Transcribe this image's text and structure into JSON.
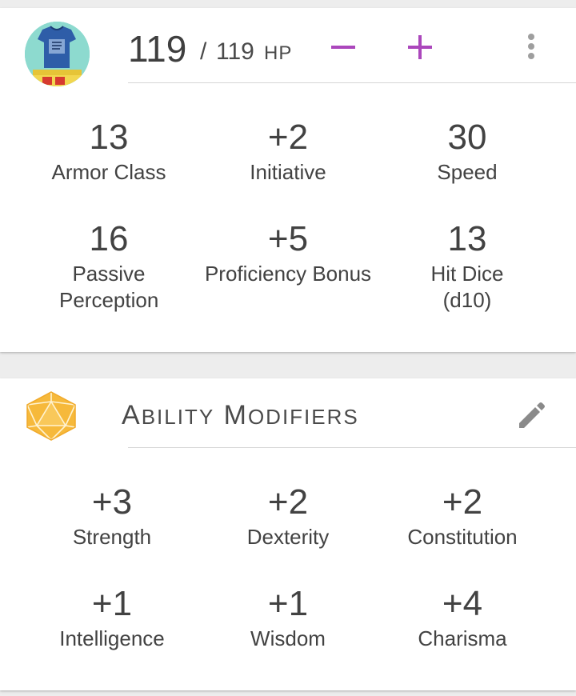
{
  "hp": {
    "current": "119",
    "separator": "/",
    "max": "119",
    "unit": "HP"
  },
  "stats": [
    {
      "value": "13",
      "label": "Armor Class"
    },
    {
      "value": "+2",
      "label": "Initiative"
    },
    {
      "value": "30",
      "label": "Speed"
    },
    {
      "value": "16",
      "label": "Passive Perception"
    },
    {
      "value": "+5",
      "label": "Proficiency Bonus"
    },
    {
      "value": "13",
      "label": "Hit Dice (d10)"
    }
  ],
  "abilities": {
    "title_first_letter_1": "A",
    "title_rest_1": "bility",
    "title_first_letter_2": "M",
    "title_rest_2": "odifiers",
    "items": [
      {
        "value": "+3",
        "label": "Strength"
      },
      {
        "value": "+2",
        "label": "Dexterity"
      },
      {
        "value": "+2",
        "label": "Constitution"
      },
      {
        "value": "+1",
        "label": "Intelligence"
      },
      {
        "value": "+1",
        "label": "Wisdom"
      },
      {
        "value": "+4",
        "label": "Charisma"
      }
    ]
  },
  "colors": {
    "accent": "#ab47bc",
    "d20": "#f6b93b",
    "icon_grey": "#757575"
  },
  "icons": {
    "minus": "minus-icon",
    "plus": "plus-icon",
    "more": "more-vert-icon",
    "edit": "pencil-icon",
    "d20": "d20-icon"
  }
}
